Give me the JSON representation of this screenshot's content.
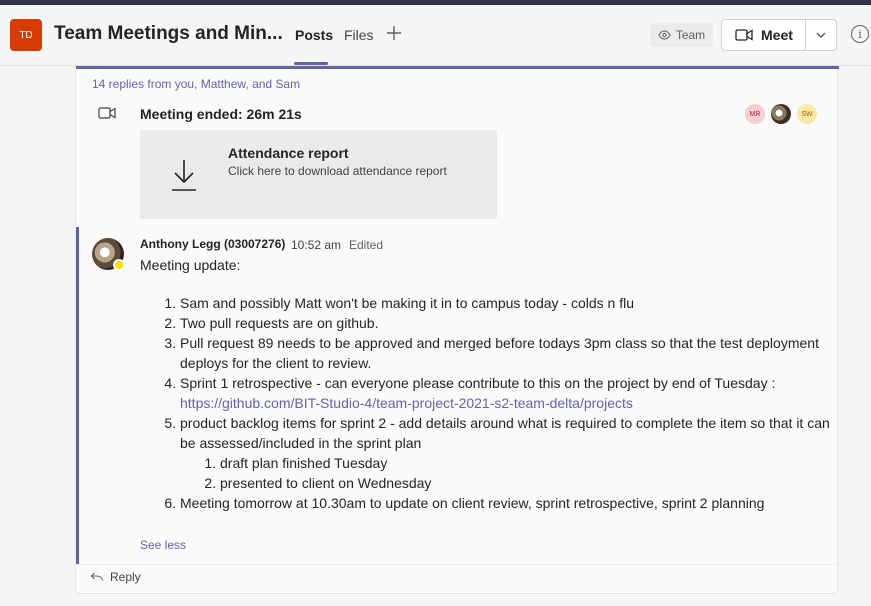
{
  "header": {
    "team_initials": "TD",
    "team_title": "Team Meetings and Min...",
    "tabs": [
      {
        "label": "Posts"
      },
      {
        "label": "Files"
      }
    ],
    "add_tab_icon": "plus-icon",
    "team_pill_label": "Team",
    "meet_label": "Meet",
    "info_glyph": "i",
    "accent": "#6264a7",
    "team_avatar_color": "#d83b01"
  },
  "thread": {
    "replies_summary": "14 replies from you, Matthew, and Sam",
    "meeting_ended": "Meeting ended: 26m 21s",
    "participants": [
      {
        "initials": "MR"
      },
      {
        "initials": ""
      },
      {
        "initials": "SW"
      }
    ],
    "attendance": {
      "title": "Attendance report",
      "subtitle": "Click here to download attendance report"
    }
  },
  "reply": {
    "author": "Anthony Legg (03007276)",
    "time": "10:52 am",
    "edited": "Edited",
    "intro": "Meeting update:",
    "items": [
      "Sam and possibly Matt won't be making it in to campus today - colds n flu",
      "Two pull requests are on github.",
      "Pull request 89 needs to be approved and merged before todays 3pm class so that the test deployment deploys for the client to review.",
      "Sprint 1 retrospective - can everyone please contribute to this on the project by end of Tuesday :",
      "product backlog items for sprint 2 - add details around what is required to complete the item so that it can be assessed/included in the sprint plan",
      "Meeting tomorrow at 10.30am to update on client review, sprint retrospective, sprint 2 planning"
    ],
    "link": "https://github.com/BIT-Studio-4/team-project-2021-s2-team-delta/projects",
    "subitems": [
      "draft plan finished Tuesday",
      "presented to client on Wednesday"
    ],
    "see_less": "See less",
    "reply_label": "Reply"
  }
}
